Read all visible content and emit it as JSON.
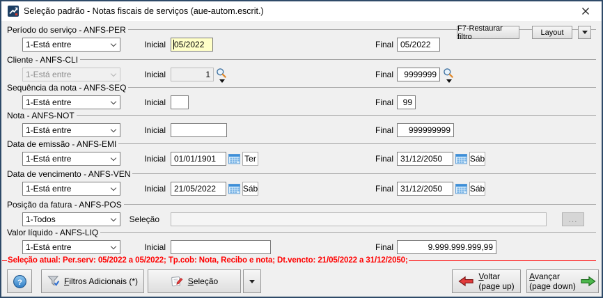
{
  "window": {
    "title": "Seleção padrão - Notas fiscais de serviços (aue-autom.escrit.)"
  },
  "colors": {
    "focused_field_bg": "#ffffc8",
    "status_text": "#ff0000",
    "window_border": "#2e4a68"
  },
  "header_buttons": {
    "restore_filter": "F7-Restaurar filtro",
    "layout": "Layout"
  },
  "labels": {
    "inicial": "Inicial",
    "final": "Final"
  },
  "groups": [
    {
      "label": "Período do serviço - ANFS-PER",
      "operator": "1-Está entre",
      "inicial": "05/2022",
      "final": "05/2022"
    },
    {
      "label": "Cliente - ANFS-CLI",
      "operator": "1-Está entre",
      "inicial": "1",
      "final": "9999999"
    },
    {
      "label": "Sequência da nota - ANFS-SEQ",
      "operator": "1-Está entre",
      "inicial": "",
      "final": "99"
    },
    {
      "label": "Nota - ANFS-NOT",
      "operator": "1-Está entre",
      "inicial": "",
      "final": "999999999"
    },
    {
      "label": "Data de emissão - ANFS-EMI",
      "operator": "1-Está entre",
      "inicial": "01/01/1901",
      "inicial_day": "Ter",
      "final": "31/12/2050",
      "final_day": "Sáb"
    },
    {
      "label": "Data de vencimento - ANFS-VEN",
      "operator": "1-Está entre",
      "inicial": "21/05/2022",
      "inicial_day": "Sáb",
      "final": "31/12/2050",
      "final_day": "Sáb"
    },
    {
      "label": "Posição da fatura - ANFS-POS",
      "operator": "1-Todos",
      "selection_label": "Seleção",
      "selection_value": "",
      "browse": "..."
    },
    {
      "label": "Valor líquido - ANFS-LIQ",
      "operator": "1-Está entre",
      "inicial": "",
      "final": "9.999.999.999,99"
    }
  ],
  "status": {
    "text": "Seleção atual: Per.serv: 05/2022 a 05/2022; Tp.cob: Nota, Recibo e nota; Dt.vencto: 21/05/2022 a 31/12/2050;"
  },
  "footer": {
    "filters": "Filtros Adicionais (*)",
    "selection": "Seleção",
    "back": "Voltar",
    "back_sub": "(page up)",
    "forward": "Avançar",
    "forward_sub": "(page down)"
  }
}
